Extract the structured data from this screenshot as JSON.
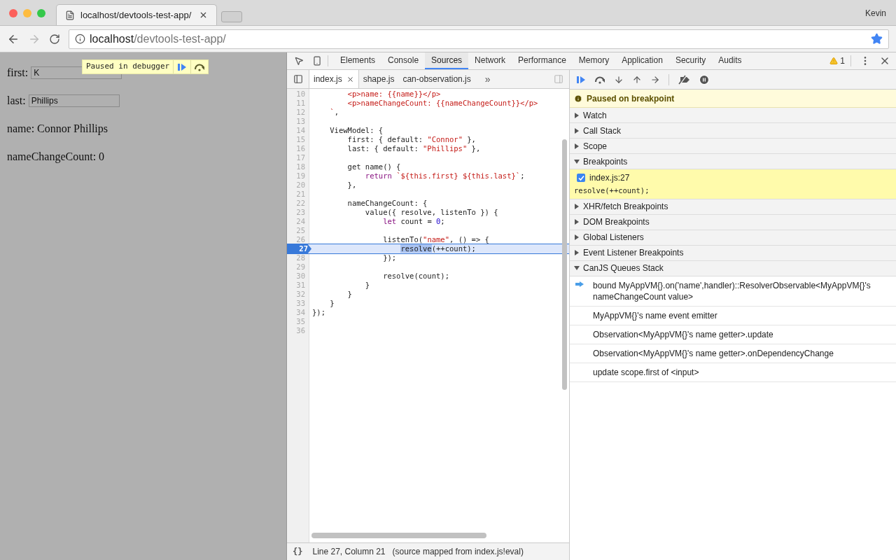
{
  "browser": {
    "tab_title": "localhost/devtools-test-app/",
    "address_host": "localhost",
    "address_path": "/devtools-test-app/",
    "profile": "Kevin"
  },
  "page": {
    "fields": [
      {
        "label": "first:",
        "value": "K"
      },
      {
        "label": "last:",
        "value": "Phillips"
      }
    ],
    "lines": [
      "name: Connor Phillips",
      "nameChangeCount: 0"
    ],
    "paused_overlay": "Paused in debugger"
  },
  "devtools": {
    "tabs": [
      {
        "label": "Elements",
        "selected": false
      },
      {
        "label": "Console",
        "selected": false
      },
      {
        "label": "Sources",
        "selected": true
      },
      {
        "label": "Network",
        "selected": false
      },
      {
        "label": "Performance",
        "selected": false
      },
      {
        "label": "Memory",
        "selected": false
      },
      {
        "label": "Application",
        "selected": false
      },
      {
        "label": "Security",
        "selected": false
      },
      {
        "label": "Audits",
        "selected": false
      }
    ],
    "warning_count": "1",
    "file_tabs": [
      {
        "label": "index.js",
        "selected": true,
        "closable": true
      },
      {
        "label": "shape.js",
        "selected": false,
        "closable": false
      },
      {
        "label": "can-observation.js",
        "selected": false,
        "closable": false
      }
    ],
    "file_tabs_overflow": "»",
    "code": [
      {
        "number": "10",
        "current": false,
        "segments": [
          {
            "kind": "string",
            "text": "        <p>name: {{name}}</p>"
          }
        ]
      },
      {
        "number": "11",
        "current": false,
        "segments": [
          {
            "kind": "string",
            "text": "        <p>nameChangeCount: {{nameChangeCount}}</p>"
          }
        ]
      },
      {
        "number": "12",
        "current": false,
        "segments": [
          {
            "kind": "string",
            "text": "    `"
          },
          {
            "kind": "plain",
            "text": ","
          }
        ]
      },
      {
        "number": "13",
        "current": false
      },
      {
        "number": "14",
        "current": false,
        "segments": [
          {
            "kind": "plain",
            "text": "    ViewModel: {"
          }
        ]
      },
      {
        "number": "15",
        "current": false,
        "segments": [
          {
            "kind": "plain",
            "text": "        first: { default: "
          },
          {
            "kind": "string",
            "text": "\"Connor\""
          },
          {
            "kind": "plain",
            "text": " },"
          }
        ]
      },
      {
        "number": "16",
        "current": false,
        "segments": [
          {
            "kind": "plain",
            "text": "        last: { default: "
          },
          {
            "kind": "string",
            "text": "\"Phillips\""
          },
          {
            "kind": "plain",
            "text": " },"
          }
        ]
      },
      {
        "number": "17",
        "current": false
      },
      {
        "number": "18",
        "current": false,
        "segments": [
          {
            "kind": "plain",
            "text": "        get name() {"
          }
        ]
      },
      {
        "number": "19",
        "current": false,
        "segments": [
          {
            "kind": "keyword",
            "text": "            return"
          },
          {
            "kind": "string",
            "text": " `${this.first} ${this.last}`"
          },
          {
            "kind": "plain",
            "text": ";"
          }
        ]
      },
      {
        "number": "20",
        "current": false,
        "segments": [
          {
            "kind": "plain",
            "text": "        },"
          }
        ]
      },
      {
        "number": "21",
        "current": false
      },
      {
        "number": "22",
        "current": false,
        "segments": [
          {
            "kind": "plain",
            "text": "        nameChangeCount: {"
          }
        ]
      },
      {
        "number": "23",
        "current": false,
        "segments": [
          {
            "kind": "plain",
            "text": "            value({ resolve, listenTo }) {"
          }
        ]
      },
      {
        "number": "24",
        "current": false,
        "segments": [
          {
            "kind": "keyword",
            "text": "                let"
          },
          {
            "kind": "plain",
            "text": " count = "
          },
          {
            "kind": "number",
            "text": "0"
          },
          {
            "kind": "plain",
            "text": ";"
          }
        ]
      },
      {
        "number": "25",
        "current": false
      },
      {
        "number": "26",
        "current": false,
        "segments": [
          {
            "kind": "plain",
            "text": "                listenTo("
          },
          {
            "kind": "string",
            "text": "\"name\""
          },
          {
            "kind": "plain",
            "text": ", () => {"
          }
        ]
      },
      {
        "number": "27",
        "current": true,
        "segments": [
          {
            "kind": "selected",
            "text": "                    resolve"
          },
          {
            "kind": "plain",
            "text": "(++count);"
          }
        ]
      },
      {
        "number": "28",
        "current": false,
        "segments": [
          {
            "kind": "plain",
            "text": "                });"
          }
        ]
      },
      {
        "number": "29",
        "current": false
      },
      {
        "number": "30",
        "current": false,
        "segments": [
          {
            "kind": "plain",
            "text": "                resolve(count);"
          }
        ]
      },
      {
        "number": "31",
        "current": false,
        "segments": [
          {
            "kind": "plain",
            "text": "            }"
          }
        ]
      },
      {
        "number": "32",
        "current": false,
        "segments": [
          {
            "kind": "plain",
            "text": "        }"
          }
        ]
      },
      {
        "number": "33",
        "current": false,
        "segments": [
          {
            "kind": "plain",
            "text": "    }"
          }
        ]
      },
      {
        "number": "34",
        "current": false,
        "segments": [
          {
            "kind": "plain",
            "text": "});"
          }
        ]
      },
      {
        "number": "35",
        "current": false
      },
      {
        "number": "36",
        "current": false
      }
    ],
    "status_bar": {
      "format_icon": "{}",
      "position": "Line 27, Column 21",
      "source": "(source mapped from index.js!eval)"
    },
    "banner": "Paused on breakpoint",
    "sections": [
      {
        "title": "Watch",
        "expanded": false
      },
      {
        "title": "Call Stack",
        "expanded": false
      },
      {
        "title": "Scope",
        "expanded": false
      },
      {
        "kind": "breakpoints",
        "title": "Breakpoints",
        "expanded": true,
        "items": [
          {
            "label": "index.js:27",
            "checked": true,
            "code": "resolve(++count);"
          }
        ]
      },
      {
        "title": "XHR/fetch Breakpoints",
        "expanded": false
      },
      {
        "title": "DOM Breakpoints",
        "expanded": false
      },
      {
        "title": "Global Listeners",
        "expanded": false
      },
      {
        "title": "Event Listener Breakpoints",
        "expanded": false
      },
      {
        "kind": "stack",
        "title": "CanJS Queues Stack",
        "expanded": true,
        "items": [
          {
            "text": "bound MyAppVM{}.on('name',handler)::ResolverObservable<MyAppVM{}'s nameChangeCount value>",
            "current": true
          },
          {
            "text": "MyAppVM{}'s name event emitter",
            "current": false
          },
          {
            "text": "Observation<MyAppVM{}'s name getter>.update",
            "current": false
          },
          {
            "text": "Observation<MyAppVM{}'s name getter>.onDependencyChange",
            "current": false
          },
          {
            "text": "update scope.first of <input>",
            "current": false
          }
        ]
      }
    ]
  }
}
